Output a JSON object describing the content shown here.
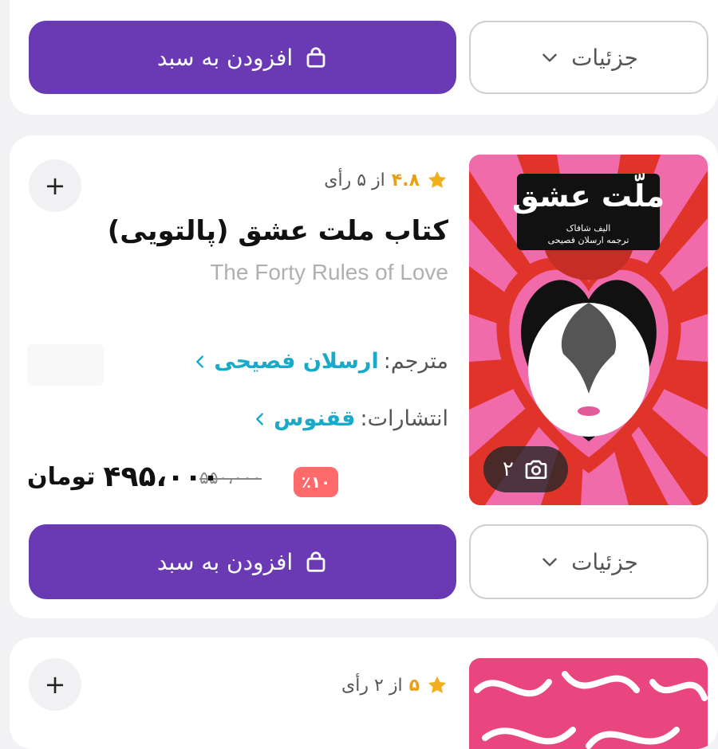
{
  "top_card": {
    "add_to_cart_label": "افزودن به سبد",
    "details_label": "جزئیات"
  },
  "product": {
    "rating_score": "۴.۸",
    "rating_text": "از ۵ رأی",
    "title_fa": "کتاب ملت عشق (پالتویی)",
    "title_en": "The Forty Rules of Love",
    "translator_label": "مترجم:",
    "translator_name": "ارسلان فصیحی",
    "publisher_label": "انتشارات:",
    "publisher_name": "ققنوس",
    "discount": "٪۱۰",
    "old_price": "۵۵۰،۰۰۰",
    "price": "۴۹۵،۰۰۰",
    "currency": "تومان",
    "photo_count": "۲",
    "cover_title": "ملّت عشق",
    "cover_author": "الیف شافاک",
    "cover_translator": "ترجمه ارسلان فصیحی",
    "add_to_cart_label": "افزودن به سبد",
    "details_label": "جزئیات",
    "plus_label": "+"
  },
  "next_product": {
    "rating_score": "۵",
    "rating_text": "از ۲ رأی",
    "plus_label": "+"
  },
  "colors": {
    "accent": "#6a3ab5",
    "link": "#19a9c9",
    "star": "#f2b01e",
    "discount": "#ff6b6b"
  },
  "icons": [
    "bag-icon",
    "chevron-down-icon",
    "star-icon",
    "camera-icon",
    "chevron-left-icon",
    "plus-icon"
  ]
}
